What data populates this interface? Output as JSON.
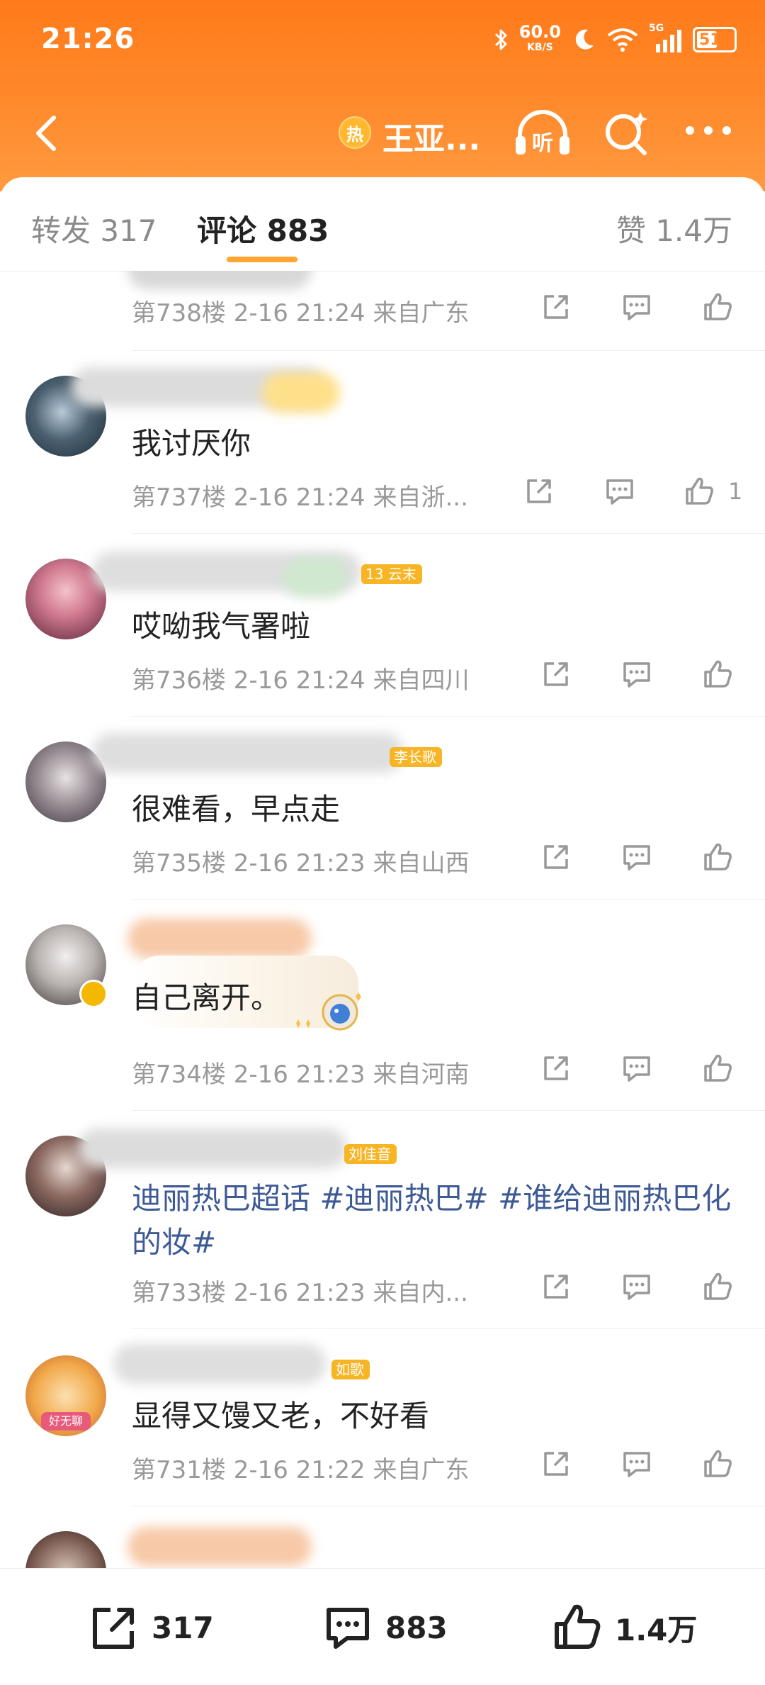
{
  "status_bar": {
    "time": "21:26",
    "net_speed": "60.0",
    "net_unit": "KB/S",
    "network": "5G",
    "battery": "51"
  },
  "navbar": {
    "hot_label": "热",
    "title": "王亚...",
    "listen_label": "听"
  },
  "tabs": {
    "repost": "转发 317",
    "comments": "评论 883",
    "likes": "赞 1.4万"
  },
  "comments": [
    {
      "floor": "第738楼",
      "date": "2-16 21:24",
      "location": "来自广东",
      "text": "",
      "likes": ""
    },
    {
      "floor": "第737楼",
      "date": "2-16 21:24",
      "location": "来自浙...",
      "text": "我讨厌你",
      "likes": "1"
    },
    {
      "floor": "第736楼",
      "date": "2-16 21:24",
      "location": "来自四川",
      "text": "哎呦我气署啦",
      "likes": "",
      "tag": "云末",
      "tag_level": "13"
    },
    {
      "floor": "第735楼",
      "date": "2-16 21:23",
      "location": "来自山西",
      "text": "很难看，早点走",
      "likes": "",
      "tag": "李长歌"
    },
    {
      "floor": "第734楼",
      "date": "2-16 21:23",
      "location": "来自河南",
      "text": "自己离开。",
      "likes": ""
    },
    {
      "floor": "第733楼",
      "date": "2-16 21:23",
      "location": "来自内...",
      "text": "迪丽热巴超话 #迪丽热巴# #谁给迪丽热巴化的妆#",
      "likes": "",
      "tag": "刘佳音"
    },
    {
      "floor": "第731楼",
      "date": "2-16 21:22",
      "location": "来自广东",
      "text": "显得又馒又老，不好看",
      "likes": "",
      "tag": "如歌",
      "avatar_label": "好无聊"
    }
  ],
  "bottom_bar": {
    "repost_count": "317",
    "comment_count": "883",
    "like_count": "1.4万"
  },
  "colors": {
    "header": "#ff7a1a",
    "accent": "#ffa531",
    "topic_link": "#3d5a96",
    "meta_text": "#999999"
  }
}
